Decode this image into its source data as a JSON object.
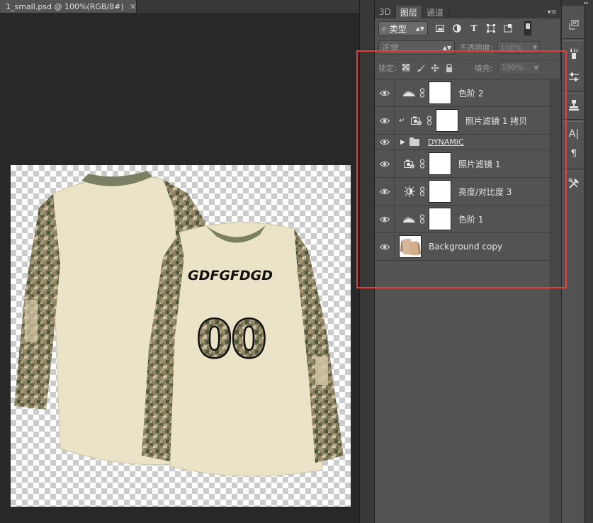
{
  "document": {
    "tab_title": "1_small.psd @ 100%(RGB/8#)",
    "close_glyph": "×"
  },
  "artwork": {
    "back_name_text": "GDFGFDGD",
    "back_number_text": "00"
  },
  "panel": {
    "tabs": [
      {
        "label": "3D"
      },
      {
        "label": "图层"
      },
      {
        "label": "通道"
      }
    ],
    "menu_glyph": "▾≡",
    "filter": {
      "selected": "类型",
      "search_glyph": "⌕"
    },
    "blend_mode": "正常",
    "opacity_label": "不透明度:",
    "opacity_value": "100%",
    "lock_label": "锁定:",
    "fill_label": "填充:",
    "fill_value": "100%"
  },
  "layers": [
    {
      "name": "色阶 2",
      "icon": "levels-icon"
    },
    {
      "name": "照片滤镜 1 拷贝",
      "icon": "photo-filter-icon",
      "clipped": true
    },
    {
      "name": "DYNAMIC",
      "type": "group"
    },
    {
      "name": "照片滤镜 1",
      "icon": "photo-filter-icon"
    },
    {
      "name": "亮度/对比度 3",
      "icon": "brightness-contrast-icon"
    },
    {
      "name": "色阶 1",
      "icon": "levels-icon"
    },
    {
      "name": "Background copy",
      "type": "pixel"
    }
  ],
  "colors": {
    "highlight_box": "#e43d3a",
    "jersey_body": "#eae2c6",
    "camo_green": "#7d7a5a",
    "panel_bg": "#535353",
    "canvas_bg": "#282828"
  }
}
